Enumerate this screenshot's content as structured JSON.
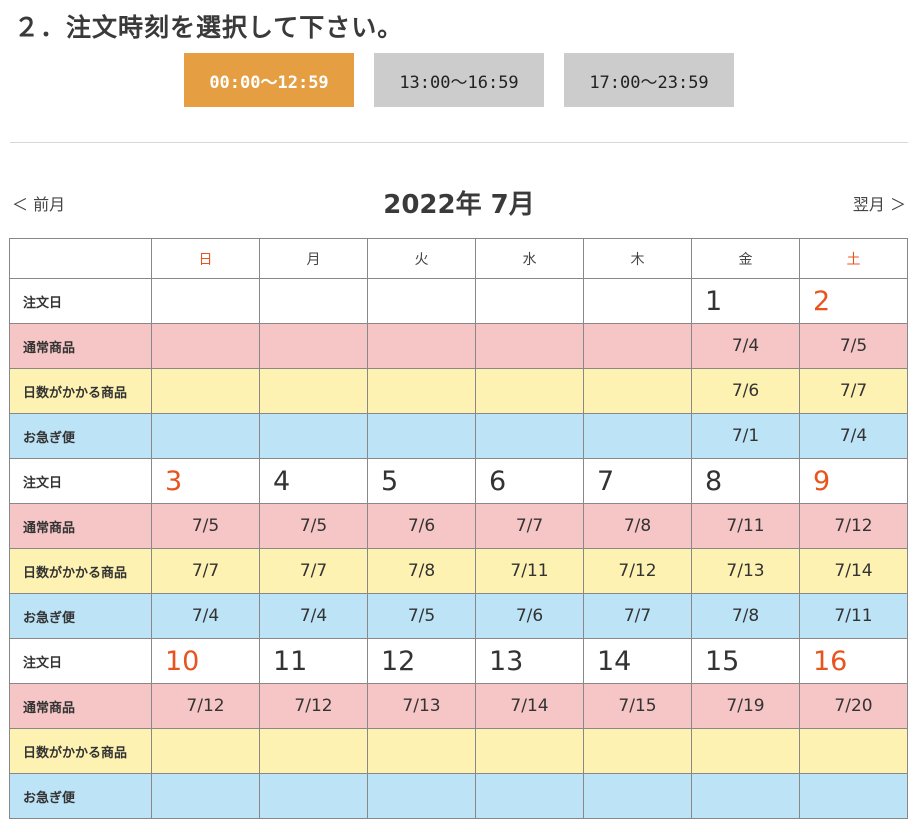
{
  "heading": "２．注文時刻を選択して下さい。",
  "time_slots": [
    {
      "label": "00:00〜12:59",
      "selected": true
    },
    {
      "label": "13:00〜16:59",
      "selected": false
    },
    {
      "label": "17:00〜23:59",
      "selected": false
    }
  ],
  "nav": {
    "prev": "＜ 前月",
    "next": "翌月 ＞",
    "month_title": "2022年 7月"
  },
  "weekdays": [
    "日",
    "月",
    "火",
    "水",
    "木",
    "金",
    "土"
  ],
  "row_labels": {
    "order": "注文日",
    "normal": "通常商品",
    "slow": "日数がかかる商品",
    "rush": "お急ぎ便"
  },
  "colors": {
    "accent": "#e59e42",
    "weekend": "#e8541e",
    "normal_bg": "#f6c6c6",
    "slow_bg": "#fdf2b2",
    "rush_bg": "#bde3f6"
  },
  "weeks": [
    {
      "days": [
        "",
        "",
        "",
        "",
        "",
        "1",
        "2"
      ],
      "normal": [
        "",
        "",
        "",
        "",
        "",
        "7/4",
        "7/5"
      ],
      "slow": [
        "",
        "",
        "",
        "",
        "",
        "7/6",
        "7/7"
      ],
      "rush": [
        "",
        "",
        "",
        "",
        "",
        "7/1",
        "7/4"
      ]
    },
    {
      "days": [
        "3",
        "4",
        "5",
        "6",
        "7",
        "8",
        "9"
      ],
      "normal": [
        "7/5",
        "7/5",
        "7/6",
        "7/7",
        "7/8",
        "7/11",
        "7/12"
      ],
      "slow": [
        "7/7",
        "7/7",
        "7/8",
        "7/11",
        "7/12",
        "7/13",
        "7/14"
      ],
      "rush": [
        "7/4",
        "7/4",
        "7/5",
        "7/6",
        "7/7",
        "7/8",
        "7/11"
      ]
    },
    {
      "days": [
        "10",
        "11",
        "12",
        "13",
        "14",
        "15",
        "16"
      ],
      "normal": [
        "7/12",
        "7/12",
        "7/13",
        "7/14",
        "7/15",
        "7/19",
        "7/20"
      ],
      "slow": [
        "",
        "",
        "",
        "",
        "",
        "",
        ""
      ],
      "rush": [
        "",
        "",
        "",
        "",
        "",
        "",
        ""
      ]
    }
  ]
}
